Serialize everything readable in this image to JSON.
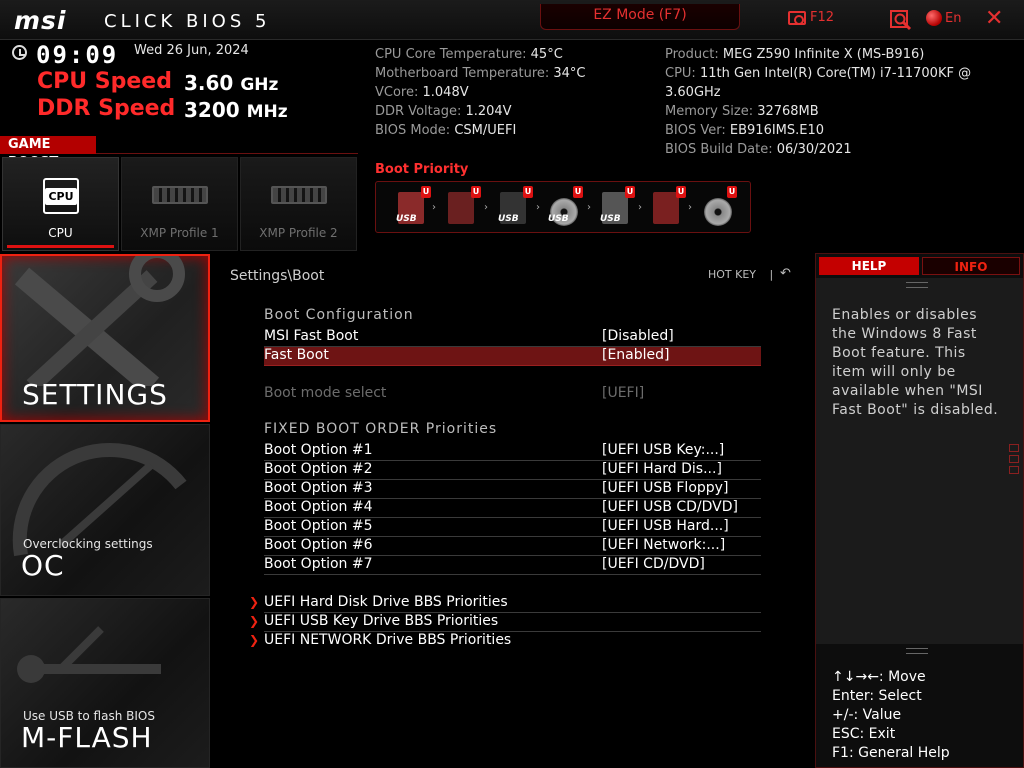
{
  "header": {
    "brand": "msi",
    "product": "CLICK BIOS 5",
    "ez_mode": "EZ Mode (F7)",
    "screenshot_label": "F12",
    "language": "En",
    "close": "✕"
  },
  "clock": {
    "time": "09:09",
    "date": "Wed  26 Jun, 2024"
  },
  "speeds": {
    "cpu_label": "CPU Speed",
    "cpu_value": "3.60",
    "cpu_unit": "GHz",
    "ddr_label": "DDR Speed",
    "ddr_value": "3200",
    "ddr_unit": "MHz"
  },
  "game_boost": {
    "label": "GAME BOOST",
    "profiles": [
      {
        "label": "CPU",
        "chip_text": "CPU"
      },
      {
        "label": "XMP Profile 1"
      },
      {
        "label": "XMP Profile 2"
      }
    ]
  },
  "sysinfo_left": [
    {
      "k": "CPU Core Temperature: ",
      "v": "45°C"
    },
    {
      "k": "Motherboard Temperature: ",
      "v": "34°C"
    },
    {
      "k": "VCore: ",
      "v": "1.048V"
    },
    {
      "k": "DDR Voltage: ",
      "v": "1.204V"
    },
    {
      "k": "BIOS Mode: ",
      "v": "CSM/UEFI"
    }
  ],
  "sysinfo_right": [
    {
      "k": "Product: ",
      "v": "MEG Z590 Infinite X (MS-B916)"
    },
    {
      "k": "CPU: ",
      "v": "11th Gen Intel(R) Core(TM) i7-11700KF @ 3.60GHz"
    },
    {
      "k": "Memory Size: ",
      "v": "32768MB"
    },
    {
      "k": "BIOS Ver: ",
      "v": "EB916IMS.E10"
    },
    {
      "k": "BIOS Build Date: ",
      "v": "06/30/2021"
    }
  ],
  "boot_priority": {
    "title": "Boot Priority",
    "badge": "U",
    "usb_label": "USB",
    "devices": [
      "usb-key-icon",
      "hard-disk-icon",
      "usb-floppy-icon",
      "usb-cd-icon",
      "usb-hard-disk-icon",
      "network-icon",
      "cd-dvd-icon"
    ]
  },
  "nav": {
    "settings": "SETTINGS",
    "oc_sub": "Overclocking settings",
    "oc": "OC",
    "mflash_sub": "Use USB to flash BIOS",
    "mflash": "M-FLASH"
  },
  "main": {
    "breadcrumb": "Settings\\Boot",
    "hotkey": "HOT KEY",
    "hotkey_sep": "|",
    "back": "↶",
    "boot_config": "Boot  Configuration",
    "msi_fast_boot": {
      "label": "MSI Fast Boot",
      "value": "[Disabled]"
    },
    "fast_boot": {
      "label": "Fast Boot",
      "value": "[Enabled]"
    },
    "boot_mode": {
      "label": "Boot mode select",
      "value": "[UEFI]"
    },
    "fixed_order": "FIXED  BOOT  ORDER  Priorities",
    "boot_options": [
      {
        "label": "Boot Option #1",
        "value": "[UEFI USB Key:...]"
      },
      {
        "label": "Boot Option #2",
        "value": "[UEFI Hard Dis...]"
      },
      {
        "label": "Boot Option #3",
        "value": "[UEFI USB Floppy]"
      },
      {
        "label": "Boot Option #4",
        "value": "[UEFI USB CD/DVD]"
      },
      {
        "label": "Boot Option #5",
        "value": "[UEFI USB Hard...]"
      },
      {
        "label": "Boot Option #6",
        "value": "[UEFI Network:...]"
      },
      {
        "label": "Boot Option #7",
        "value": "[UEFI CD/DVD]"
      }
    ],
    "submenus": [
      "UEFI Hard Disk Drive BBS Priorities",
      "UEFI USB Key Drive BBS Priorities",
      "UEFI NETWORK Drive BBS Priorities"
    ]
  },
  "help": {
    "tab_help": "HELP",
    "tab_info": "INFO",
    "text": "Enables or disables the Windows 8 Fast Boot feature. This item will only be available when \"MSI Fast Boot\" is disabled.",
    "keys": [
      "↑↓→←: Move",
      "Enter: Select",
      "+/-: Value",
      "ESC: Exit",
      "F1: General Help"
    ]
  },
  "colors": {
    "accent": "#e21a1a",
    "selected_row": "#6e1414",
    "background": "#000000"
  }
}
